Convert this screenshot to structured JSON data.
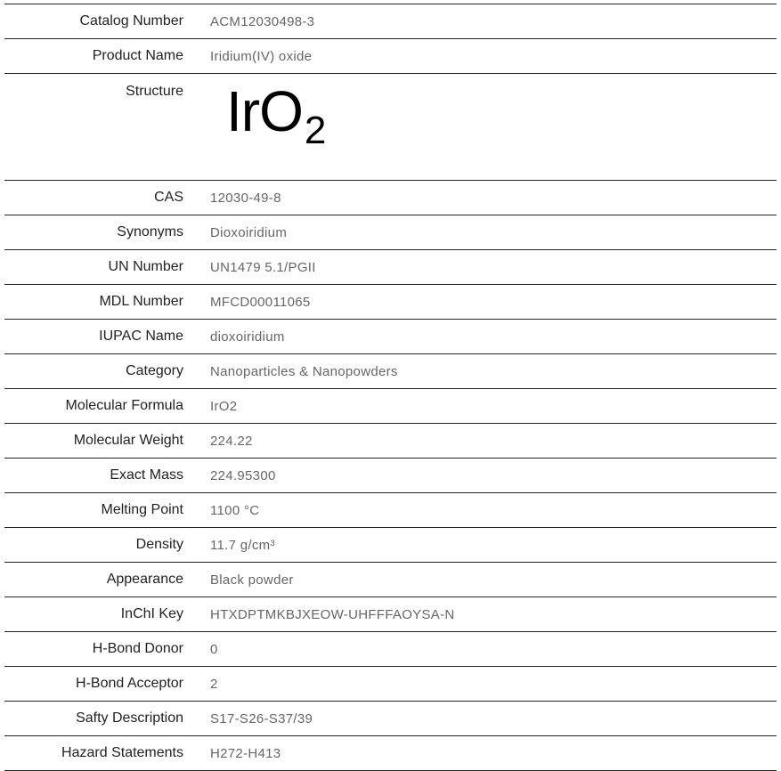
{
  "rows": [
    {
      "label": "Catalog Number",
      "value": "ACM12030498-3"
    },
    {
      "label": "Product Name",
      "value": "Iridium(IV) oxide"
    },
    {
      "label": "Structure",
      "structure": {
        "element": "IrO",
        "subscript": "2"
      }
    },
    {
      "label": "CAS",
      "value": "12030-49-8"
    },
    {
      "label": "Synonyms",
      "value": "Dioxoiridium"
    },
    {
      "label": "UN Number",
      "value": "UN1479 5.1/PGII"
    },
    {
      "label": "MDL Number",
      "value": "MFCD00011065"
    },
    {
      "label": "IUPAC Name",
      "value": "dioxoiridium"
    },
    {
      "label": "Category",
      "value": "Nanoparticles & Nanopowders"
    },
    {
      "label": "Molecular Formula",
      "value": "IrO2"
    },
    {
      "label": "Molecular Weight",
      "value": "224.22"
    },
    {
      "label": "Exact Mass",
      "value": "224.95300"
    },
    {
      "label": "Melting Point",
      "value": "1100 °C"
    },
    {
      "label": "Density",
      "value": "11.7 g/cm³"
    },
    {
      "label": "Appearance",
      "value": "Black powder"
    },
    {
      "label": "InChI Key",
      "value": "HTXDPTMKBJXEOW-UHFFFAOYSA-N"
    },
    {
      "label": "H-Bond Donor",
      "value": "0"
    },
    {
      "label": "H-Bond Acceptor",
      "value": "2"
    },
    {
      "label": "Safty Description",
      "value": "S17-S26-S37/39"
    },
    {
      "label": "Hazard Statements",
      "value": "H272-H413"
    }
  ]
}
